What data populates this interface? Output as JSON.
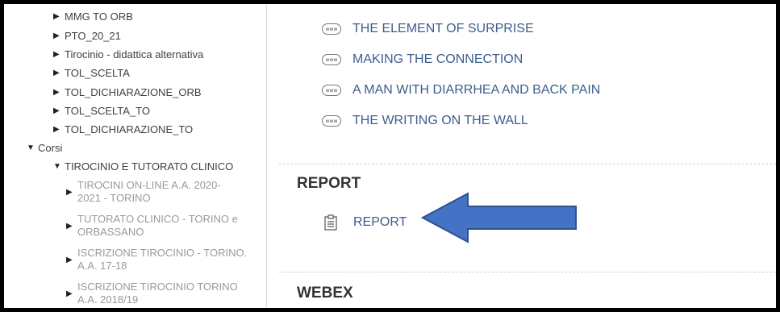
{
  "sidebar": {
    "items": [
      {
        "label": "MMG TO ORB",
        "icon": "triangle-right-icon"
      },
      {
        "label": "PTO_20_21",
        "icon": "triangle-right-icon"
      },
      {
        "label": "Tirocinio - didattica alternativa",
        "icon": "triangle-right-icon"
      },
      {
        "label": "TOL_SCELTA",
        "icon": "triangle-right-icon"
      },
      {
        "label": "TOL_DICHIARAZIONE_ORB",
        "icon": "triangle-right-icon"
      },
      {
        "label": "TOL_SCELTA_TO",
        "icon": "triangle-right-icon"
      },
      {
        "label": "TOL_DICHIARAZIONE_TO",
        "icon": "triangle-right-icon"
      }
    ],
    "corsi": {
      "label": "Corsi",
      "icon": "triangle-down-icon"
    },
    "tirocinio_group": {
      "label": "TIROCINIO E TUTORATO CLINICO",
      "icon": "triangle-down-icon"
    },
    "sub_items": [
      {
        "line1": "TIROCINI ON-LINE A.A. 2020-",
        "line2": "2021 - TORINO"
      },
      {
        "line1": "TUTORATO CLINICO - TORINO e",
        "line2": "ORBASSANO"
      },
      {
        "line1": "ISCRIZIONE TIROCINIO - TORINO.",
        "line2": "A.A. 17-18"
      },
      {
        "line1": "ISCRIZIONE TIROCINIO TORINO",
        "line2": "A.A. 2018/19"
      }
    ]
  },
  "main": {
    "links": [
      {
        "label": "THE ELEMENT OF SURPRISE",
        "icon": "www-icon"
      },
      {
        "label": "MAKING THE CONNECTION",
        "icon": "www-icon"
      },
      {
        "label": "A MAN WITH DIARRHEA AND BACK PAIN",
        "icon": "www-icon"
      },
      {
        "label": "THE WRITING ON THE WALL",
        "icon": "www-icon"
      }
    ],
    "www_icon_text": "www",
    "report_section": {
      "title": "REPORT",
      "link_label": "REPORT",
      "icon": "clipboard-icon"
    },
    "webex_section": {
      "title": "WEBEX"
    }
  },
  "colors": {
    "link": "#3e5d8c",
    "arrow": "#4472c4",
    "arrow_border": "#2f528f"
  }
}
